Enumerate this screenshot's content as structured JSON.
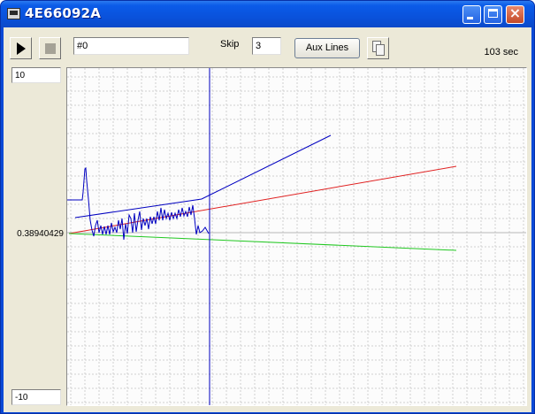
{
  "window": {
    "title": "4E66092A",
    "buttons": {
      "minimize": "minimize-icon",
      "maximize": "maximize-icon",
      "close": "×"
    }
  },
  "toolbar": {
    "play_icon": "play-icon",
    "stop_icon": "stop-icon",
    "channel_value": "#0",
    "skip_label": "Skip",
    "skip_value": "3",
    "aux_lines_label": "Aux Lines",
    "copy_icon": "copy-icon",
    "elapsed": "103 sec"
  },
  "scale": {
    "y_max": "10",
    "y_min": "-10",
    "cursor_value": "0.38940429"
  },
  "colors": {
    "signal": "#0000c0",
    "aux_red": "#e02020",
    "aux_green": "#22c822",
    "cursor": "#0000c0",
    "grid": "#d0d0d0"
  }
}
